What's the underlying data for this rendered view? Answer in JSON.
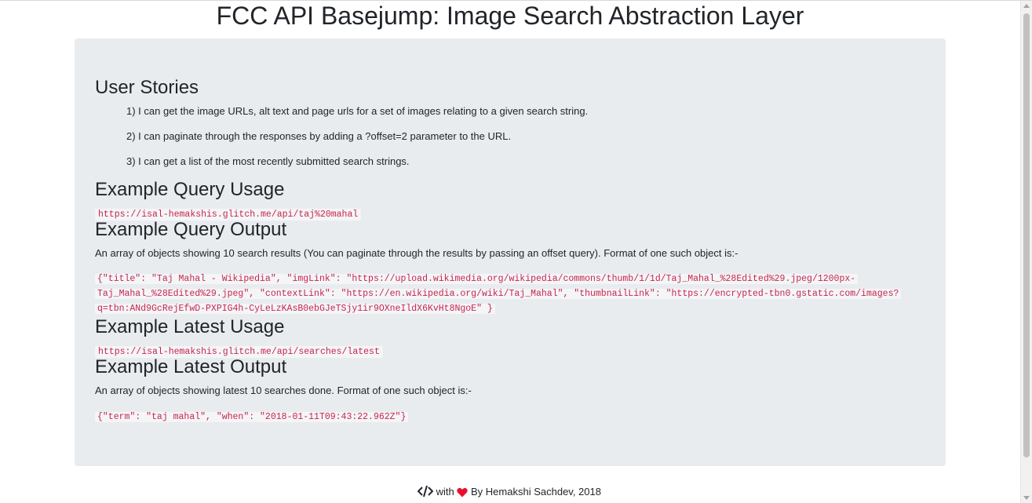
{
  "page": {
    "title": "FCC API Basejump: Image Search Abstraction Layer"
  },
  "user_stories": {
    "heading": "User Stories",
    "items": [
      "1) I can get the image URLs, alt text and page urls for a set of images relating to a given search string.",
      "2) I can paginate through the responses by adding a ?offset=2 parameter to the URL.",
      "3) I can get a list of the most recently submitted search strings."
    ]
  },
  "query_usage": {
    "heading": "Example Query Usage",
    "url": "https://isal-hemakshis.glitch.me/api/taj%20mahal"
  },
  "query_output": {
    "heading": "Example Query Output",
    "description": "An array of objects showing 10 search results (You can paginate through the results by passing an offset query). Format of one such object is:-",
    "code_lines": [
      "{\"title\": \"Taj Mahal - Wikipedia\", \"imgLink\": \"https://upload.wikimedia.org/wikipedia/commons/thumb/1/1d/Taj_Mahal_%28Edited%29.jpeg/1200px-",
      "Taj_Mahal_%28Edited%29.jpeg\", \"contextLink\": \"https://en.wikipedia.org/wiki/Taj_Mahal\", \"thumbnailLink\": \"https://encrypted-tbn0.gstatic.com/images?",
      "q=tbn:ANd9GcRejEfwD-PXPIG4h-CyLeLzKAsB0ebGJeTSjy1ir9OXneIldX6KvHt8NgoE\" }"
    ]
  },
  "latest_usage": {
    "heading": "Example Latest Usage",
    "url": "https://isal-hemakshis.glitch.me/api/searches/latest"
  },
  "latest_output": {
    "heading": "Example Latest Output",
    "description": "An array of objects showing latest 10 searches done. Format of one such object is:-",
    "code": "{\"term\": \"taj mahal\", \"when\": \"2018-01-11T09:43:22.962Z\"}"
  },
  "footer": {
    "with_text": "with",
    "by_text": "By Hemakshi Sachdev, 2018",
    "code_icon": "code-icon",
    "heart_icon": "heart-icon",
    "heart_color": "#e8112d"
  }
}
